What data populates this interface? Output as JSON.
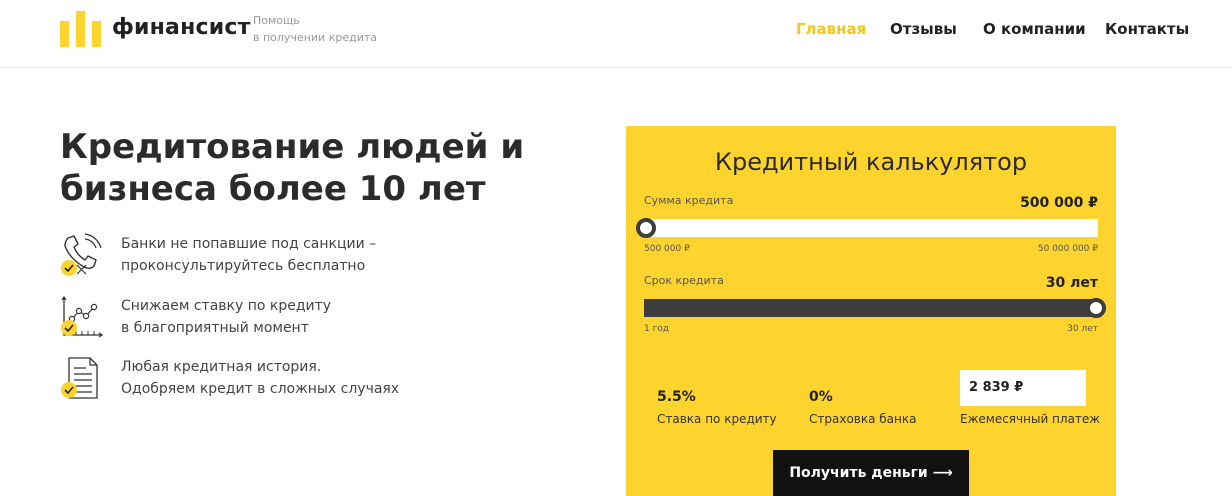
{
  "header": {
    "logo_name": "финансист",
    "tagline_line1": "Помощь",
    "tagline_line2": "в получении кредита",
    "nav": [
      "Главная",
      "Отзывы",
      "О компании",
      "Контакты"
    ],
    "active_nav": "Главная",
    "accent_color": "#f5c518"
  },
  "hero": {
    "title_line1": "Кредитование людей и",
    "title_line2": "бизнеса более 10 лет",
    "features": [
      {
        "icon": "phone-check-icon",
        "line1": "Банки не попавшие под санкции –",
        "line2": "проконсультируйтесь бесплатно"
      },
      {
        "icon": "chart-check-icon",
        "line1": "Снижаем ставку по кредиту",
        "line2": "в благоприятный момент"
      },
      {
        "icon": "document-check-icon",
        "line1": "Любая кредитная история.",
        "line2": "Одобряем кредит в сложных случаях"
      }
    ]
  },
  "calculator": {
    "title": "Кредитный калькулятор",
    "background_color": "#fdd32d",
    "amount": {
      "label": "Сумма кредита",
      "value": "500 000 ₽",
      "min_label": "500 000 ₽",
      "max_label": "50 000 000 ₽",
      "slider_fraction": 0
    },
    "term": {
      "label": "Срок кредита",
      "value": "30 лет",
      "min_label": "1 год",
      "max_label": "30 лет",
      "slider_fraction": 1
    },
    "rate_value": "5.5%",
    "rate_label": "Ставка по кредиту",
    "insurance_value": "0%",
    "insurance_label": "Страховка банка",
    "payment_value": "2 839 ₽",
    "payment_label": "Ежемесячный платеж",
    "cta_label": "Получить деньги ⟶"
  }
}
